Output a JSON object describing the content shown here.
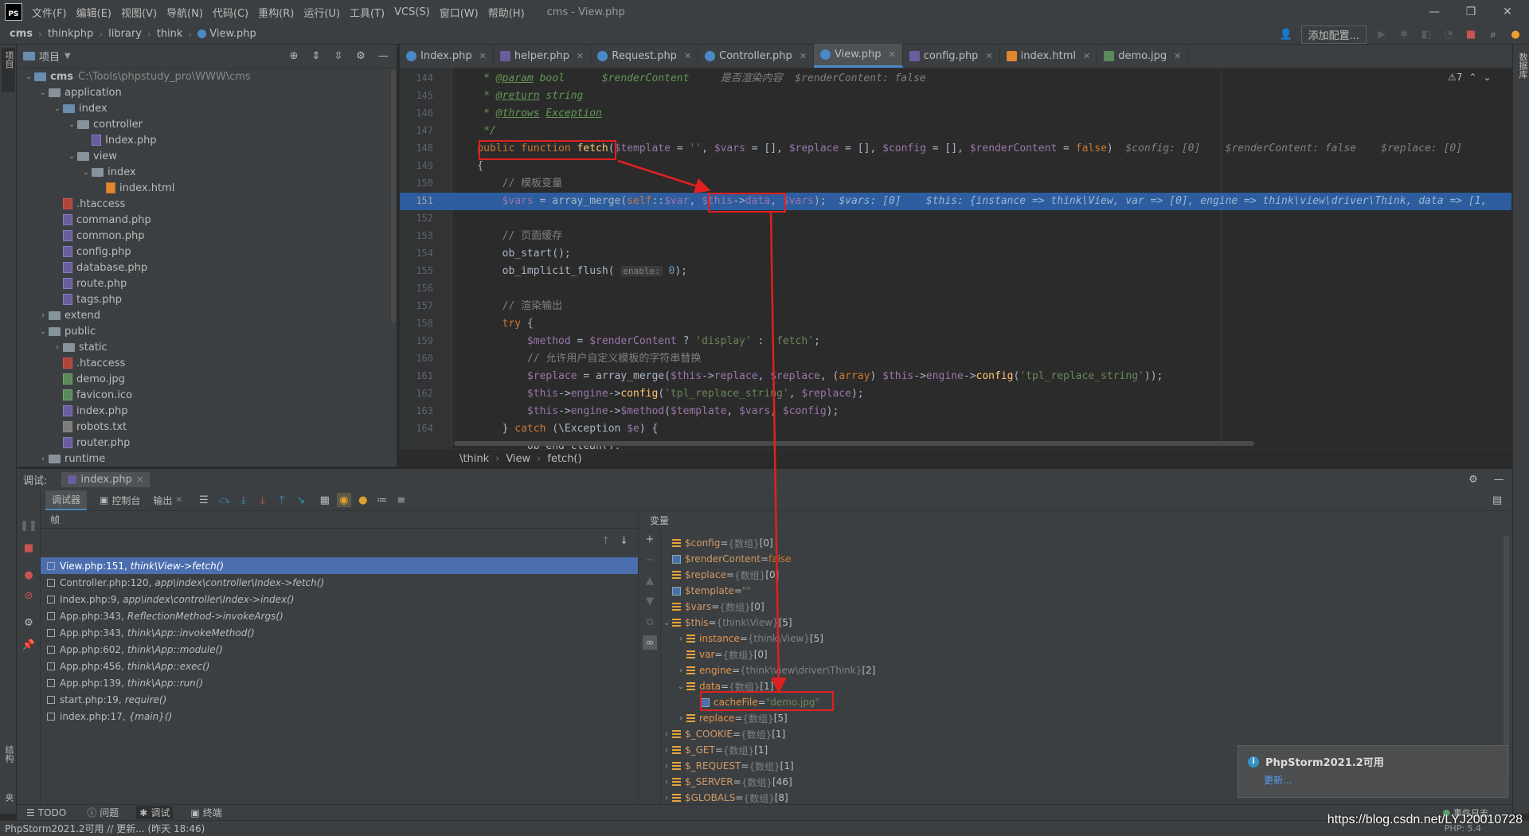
{
  "menubar": {
    "logo": "PS",
    "items": [
      "文件(F)",
      "编辑(E)",
      "视图(V)",
      "导航(N)",
      "代码(C)",
      "重构(R)",
      "运行(U)",
      "工具(T)",
      "VCS(S)",
      "窗口(W)",
      "帮助(H)"
    ],
    "window_title": "cms - View.php"
  },
  "navbar": {
    "crumbs": [
      "cms",
      "thinkphp",
      "library",
      "think",
      "View.php"
    ],
    "add_config": "添加配置..."
  },
  "project": {
    "title": "项目",
    "tree": [
      {
        "label": "cms",
        "extra": "C:\\Tools\\phpstudy_pro\\WWW\\cms",
        "depth": 0,
        "type": "folder",
        "open": true,
        "bold": true
      },
      {
        "label": "application",
        "depth": 1,
        "type": "folder",
        "open": true
      },
      {
        "label": "index",
        "depth": 2,
        "type": "folder",
        "open": true
      },
      {
        "label": "controller",
        "depth": 3,
        "type": "folder",
        "open": true
      },
      {
        "label": "Index.php",
        "depth": 4,
        "type": "php"
      },
      {
        "label": "view",
        "depth": 3,
        "type": "folder",
        "open": true
      },
      {
        "label": "index",
        "depth": 4,
        "type": "folder",
        "open": true
      },
      {
        "label": "index.html",
        "depth": 5,
        "type": "html"
      },
      {
        "label": ".htaccess",
        "depth": 2,
        "type": "ht"
      },
      {
        "label": "command.php",
        "depth": 2,
        "type": "php"
      },
      {
        "label": "common.php",
        "depth": 2,
        "type": "php"
      },
      {
        "label": "config.php",
        "depth": 2,
        "type": "php"
      },
      {
        "label": "database.php",
        "depth": 2,
        "type": "php"
      },
      {
        "label": "route.php",
        "depth": 2,
        "type": "php"
      },
      {
        "label": "tags.php",
        "depth": 2,
        "type": "php"
      },
      {
        "label": "extend",
        "depth": 1,
        "type": "folder",
        "open": false
      },
      {
        "label": "public",
        "depth": 1,
        "type": "folder",
        "open": true
      },
      {
        "label": "static",
        "depth": 2,
        "type": "folder",
        "open": false
      },
      {
        "label": ".htaccess",
        "depth": 2,
        "type": "ht"
      },
      {
        "label": "demo.jpg",
        "depth": 2,
        "type": "img"
      },
      {
        "label": "favicon.ico",
        "depth": 2,
        "type": "img"
      },
      {
        "label": "index.php",
        "depth": 2,
        "type": "php"
      },
      {
        "label": "robots.txt",
        "depth": 2,
        "type": "txt"
      },
      {
        "label": "router.php",
        "depth": 2,
        "type": "php"
      },
      {
        "label": "runtime",
        "depth": 1,
        "type": "folder",
        "open": false
      }
    ]
  },
  "left_strip": {
    "project_label": "项目",
    "structure_label": "结构",
    "favorites_label": "收藏夹"
  },
  "right_strip": {
    "db_label": "数据库"
  },
  "tabs": [
    {
      "label": "Index.php",
      "icon": "c"
    },
    {
      "label": "helper.php",
      "icon": "php"
    },
    {
      "label": "Request.php",
      "icon": "c"
    },
    {
      "label": "Controller.php",
      "icon": "c"
    },
    {
      "label": "View.php",
      "icon": "c",
      "active": true
    },
    {
      "label": "config.php",
      "icon": "php"
    },
    {
      "label": "index.html",
      "icon": "html"
    },
    {
      "label": "demo.jpg",
      "icon": "img"
    }
  ],
  "editor": {
    "warnings": "⚠7",
    "line_numbers": [
      "144",
      "145",
      "146",
      "147",
      "148",
      "149",
      "150",
      "151",
      "152",
      "153",
      "154",
      "155",
      "156",
      "157",
      "158",
      "159",
      "160",
      "161",
      "162",
      "163",
      "164"
    ],
    "current_line": "151",
    "breadcrumb": [
      "\\think",
      "View",
      "fetch()"
    ]
  },
  "debug": {
    "title": "调试:",
    "session_tab": "index.php",
    "tabs": [
      "调试器",
      "控制台",
      "输出"
    ],
    "frames_label": "帧",
    "vars_label": "变量",
    "frames": [
      {
        "file": "View.php:151,",
        "fn": "think\\View->fetch()",
        "selected": true
      },
      {
        "file": "Controller.php:120,",
        "fn": "app\\index\\controller\\Index->fetch()"
      },
      {
        "file": "Index.php:9,",
        "fn": "app\\index\\controller\\Index->index()"
      },
      {
        "file": "App.php:343,",
        "fn": "ReflectionMethod->invokeArgs()"
      },
      {
        "file": "App.php:343,",
        "fn": "think\\App::invokeMethod()"
      },
      {
        "file": "App.php:602,",
        "fn": "think\\App::module()"
      },
      {
        "file": "App.php:456,",
        "fn": "think\\App::exec()"
      },
      {
        "file": "App.php:139,",
        "fn": "think\\App::run()"
      },
      {
        "file": "start.php:19,",
        "fn": "require()"
      },
      {
        "file": "index.php:17,",
        "fn": "{main}()"
      }
    ],
    "variables": [
      {
        "indent": 0,
        "arrow": "",
        "icon": "arr",
        "name": "$config",
        "type": "{数组}",
        "val": "[0]"
      },
      {
        "indent": 0,
        "arrow": "",
        "icon": "obj",
        "name": "$renderContent",
        "type": "",
        "val": "false",
        "valclass": "vbool"
      },
      {
        "indent": 0,
        "arrow": "",
        "icon": "arr",
        "name": "$replace",
        "type": "{数组}",
        "val": "[0]"
      },
      {
        "indent": 0,
        "arrow": "",
        "icon": "obj",
        "name": "$template",
        "type": "",
        "val": "\"\"",
        "valclass": "vstr"
      },
      {
        "indent": 0,
        "arrow": "",
        "icon": "arr",
        "name": "$vars",
        "type": "{数组}",
        "val": "[0]"
      },
      {
        "indent": 0,
        "arrow": "▾",
        "icon": "arr",
        "name": "$this",
        "type": "{think\\View}",
        "val": "[5]"
      },
      {
        "indent": 1,
        "arrow": "›",
        "icon": "arr",
        "name": "instance",
        "type": "{think\\View}",
        "val": "[5]"
      },
      {
        "indent": 1,
        "arrow": "",
        "icon": "arr",
        "name": "var",
        "type": "{数组}",
        "val": "[0]"
      },
      {
        "indent": 1,
        "arrow": "›",
        "icon": "arr",
        "name": "engine",
        "type": "{think\\view\\driver\\Think}",
        "val": "[2]"
      },
      {
        "indent": 1,
        "arrow": "▾",
        "icon": "arr",
        "name": "data",
        "type": "{数组}",
        "val": "[1]"
      },
      {
        "indent": 2,
        "arrow": "",
        "icon": "obj",
        "name": "cacheFile",
        "type": "",
        "val": "\"demo.jpg\"",
        "valclass": "vstr",
        "boxed": true
      },
      {
        "indent": 1,
        "arrow": "›",
        "icon": "arr",
        "name": "replace",
        "type": "{数组}",
        "val": "[5]"
      },
      {
        "indent": 0,
        "arrow": "›",
        "icon": "arr",
        "name": "$_COOKIE",
        "type": "{数组}",
        "val": "[1]"
      },
      {
        "indent": 0,
        "arrow": "›",
        "icon": "arr",
        "name": "$_GET",
        "type": "{数组}",
        "val": "[1]"
      },
      {
        "indent": 0,
        "arrow": "›",
        "icon": "arr",
        "name": "$_REQUEST",
        "type": "{数组}",
        "val": "[1]"
      },
      {
        "indent": 0,
        "arrow": "›",
        "icon": "arr",
        "name": "$_SERVER",
        "type": "{数组}",
        "val": "[46]"
      },
      {
        "indent": 0,
        "arrow": "›",
        "icon": "arr",
        "name": "$GLOBALS",
        "type": "{数组}",
        "val": "[8]"
      }
    ]
  },
  "notification": {
    "title": "PhpStorm2021.2可用",
    "link": "更新..."
  },
  "toolstrip": [
    "TODO",
    "问题",
    "调试",
    "终端"
  ],
  "status": {
    "text": "PhpStorm2021.2可用 // 更新... (昨天 18:46)",
    "event_log": "事件日志",
    "php": "PHP: 5.4"
  },
  "watermark": "https://blog.csdn.net/LYJ20010728"
}
